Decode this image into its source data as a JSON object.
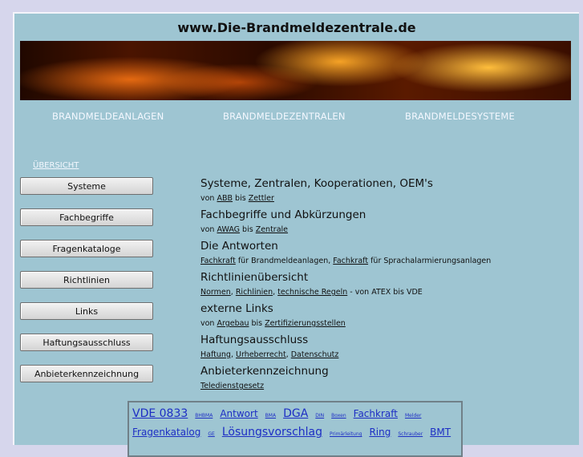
{
  "site_title": "www.Die-Brandmeldezentrale.de",
  "top_nav": [
    "BRANDMELDEANLAGEN",
    "BRANDMELDEZENTRALEN",
    "BRANDMELDESYSTEME"
  ],
  "overview_link": "ÜBERSICHT",
  "menu": [
    "Systeme",
    "Fachbegriffe",
    "Fragenkataloge",
    "Richtlinien",
    "Links",
    "Haftungsausschluss",
    "Anbieterkennzeichnung"
  ],
  "sections": [
    {
      "title": "Systeme, Zentralen, Kooperationen, OEM's",
      "parts": [
        {
          "t": "von "
        },
        {
          "link": "ABB"
        },
        {
          "t": " bis "
        },
        {
          "link": "Zettler"
        }
      ]
    },
    {
      "title": "Fachbegriffe und Abkürzungen",
      "parts": [
        {
          "t": "von "
        },
        {
          "link": "AWAG"
        },
        {
          "t": " bis "
        },
        {
          "link": "Zentrale"
        }
      ]
    },
    {
      "title": "Die Antworten",
      "parts": [
        {
          "link": "Fachkraft"
        },
        {
          "t": " für Brandmeldeanlagen, "
        },
        {
          "link": "Fachkraft"
        },
        {
          "t": " für Sprachalarmierungsanlagen"
        }
      ]
    },
    {
      "title": "Richtlinienübersicht",
      "parts": [
        {
          "link": "Normen"
        },
        {
          "t": ", "
        },
        {
          "link": "Richlinien"
        },
        {
          "t": ", "
        },
        {
          "link": "technische Regeln"
        },
        {
          "t": " - von ATEX bis VDE"
        }
      ]
    },
    {
      "title": "externe Links",
      "parts": [
        {
          "t": "von "
        },
        {
          "link": "Argebau"
        },
        {
          "t": " bis "
        },
        {
          "link": "Zertifizierungsstellen"
        }
      ]
    },
    {
      "title": "Haftungsausschluss",
      "parts": [
        {
          "link": "Haftung"
        },
        {
          "t": ", "
        },
        {
          "link": "Urheberrecht"
        },
        {
          "t": ", "
        },
        {
          "link": "Datenschutz"
        }
      ]
    },
    {
      "title": "Anbieterkennzeichnung",
      "parts": [
        {
          "link": "Teledienstgesetz"
        }
      ]
    }
  ],
  "tag_cloud": {
    "line1": [
      {
        "text": "VDE 0833",
        "size": "lg"
      },
      {
        "text": "BHBMA",
        "size": "sm"
      },
      {
        "text": "Antwort",
        "size": "md"
      },
      {
        "text": "BMA",
        "size": "sm"
      },
      {
        "text": "DGA",
        "size": "lg"
      },
      {
        "text": "DIN",
        "size": "sm"
      },
      {
        "text": "Boxen",
        "size": "sm"
      },
      {
        "text": "Fachkraft",
        "size": "md"
      },
      {
        "text": "Melder",
        "size": "sm"
      }
    ],
    "line2": [
      {
        "text": "Fragenkatalog",
        "size": "md"
      },
      {
        "text": "GE",
        "size": "sm"
      },
      {
        "text": "Lösungsvorschlag",
        "size": "lg"
      },
      {
        "text": "Primärleitung",
        "size": "sm"
      },
      {
        "text": "Ring",
        "size": "md"
      },
      {
        "text": "Schrauber",
        "size": "sm"
      },
      {
        "text": "BMT",
        "size": "md"
      }
    ]
  }
}
